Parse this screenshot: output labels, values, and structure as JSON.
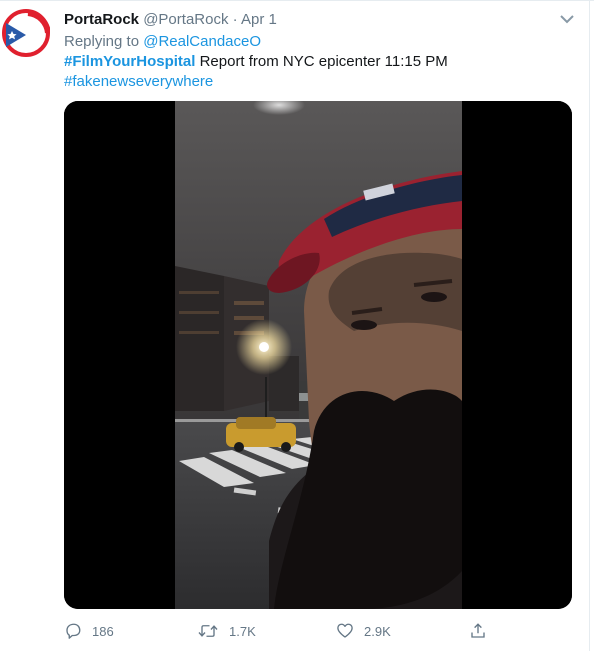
{
  "tweet": {
    "display_name": "PortaRock",
    "handle": "@PortaRock",
    "separator": "·",
    "date": "Apr 1",
    "replying_prefix": "Replying to",
    "replying_to": "@RealCandaceO",
    "hashtag_primary": "#FilmYourHospital",
    "text": "Report from NYC epicenter 11:15 PM",
    "hashtag_secondary": "#fakenewseverywhere"
  },
  "actions": {
    "reply_count": "186",
    "retweet_count": "1.7K",
    "like_count": "2.9K"
  },
  "colors": {
    "link": "#1b95e0",
    "muted": "#657786",
    "avatar_red": "#e0202e",
    "avatar_blue": "#2a5aa8"
  },
  "icons": [
    "more-chevron-icon",
    "reply-icon",
    "retweet-icon",
    "like-icon",
    "share-icon"
  ]
}
